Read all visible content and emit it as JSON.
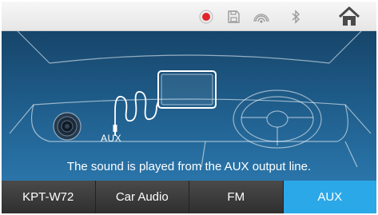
{
  "status_bar": {
    "icons": [
      "record-icon",
      "save-icon",
      "cast-icon",
      "bluetooth-icon",
      "home-icon"
    ],
    "record_color": "#e0252b"
  },
  "main": {
    "aux_label": "AUX",
    "message": "The sound is played from the AUX output line."
  },
  "tabs": [
    {
      "label": "KPT-W72",
      "active": false
    },
    {
      "label": "Car Audio",
      "active": false
    },
    {
      "label": "FM",
      "active": false
    },
    {
      "label": "AUX",
      "active": true
    }
  ],
  "colors": {
    "active_tab": "#2ba8e8",
    "panel_top": "#17456a",
    "panel_bottom": "#2a75aa"
  }
}
